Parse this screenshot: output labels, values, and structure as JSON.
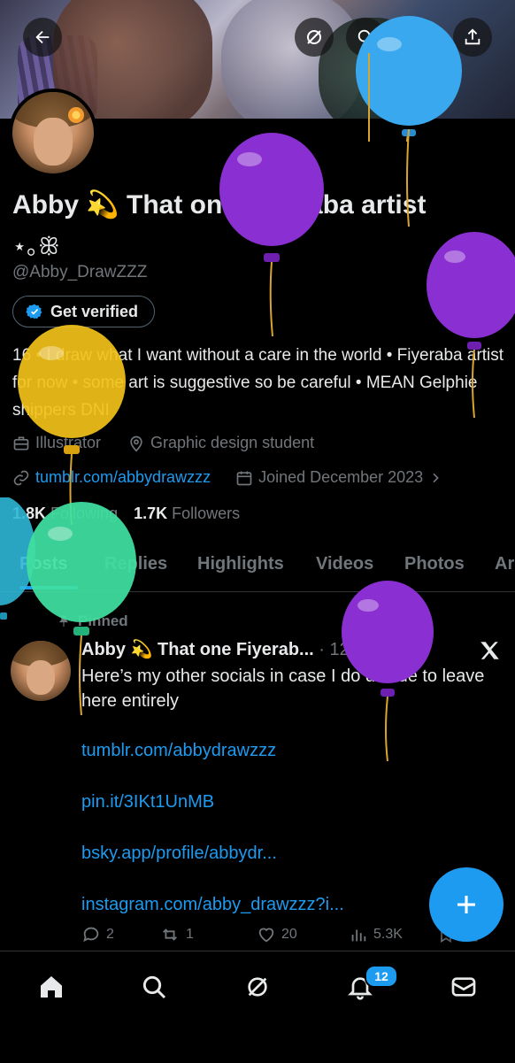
{
  "profile": {
    "display_name": "Abby 💫 That one Fiyeraba artist",
    "display_name_cont": "⋆｡ꕥ",
    "handle": "@Abby_DrawZZZ",
    "verify_label": "Get verified",
    "bio": "16 • I draw what I want without a care in the world • Fiyeraba artist for now • some art is suggestive so be careful • MEAN Gelphie shippers DNI",
    "category": "Illustrator",
    "location": "Graphic design student",
    "website": "tumblr.com/abbydrawzzz",
    "joined": "Joined December 2023",
    "following_count": "1.8K",
    "following_label": "Following",
    "followers_count": "1.7K",
    "followers_label": "Followers"
  },
  "tabs": [
    "Posts",
    "Replies",
    "Highlights",
    "Videos",
    "Photos",
    "Ar"
  ],
  "pinned_label": "Pinned",
  "post": {
    "author": "Abby 💫 That one Fiyerab...",
    "separator": "·",
    "date": "12/24/25",
    "text": "Here’s my other socials in case I do decide to leave here entirely",
    "links": [
      "tumblr.com/abbydrawzzz",
      "pin.it/3IKt1UnMB",
      "bsky.app/profile/abbydr...",
      "instagram.com/abby_drawzzz?i..."
    ],
    "replies": "2",
    "reposts": "1",
    "likes": "20",
    "views": "5.3K"
  },
  "notifications_badge": "12",
  "colors": {
    "accent": "#1d9bf0",
    "text": "#e7e9ea",
    "secondary": "#71767b",
    "balloon_purple": "#8a2fd1",
    "balloon_blue": "#3aa8ee",
    "balloon_yellow": "#f2c21a",
    "balloon_green": "#3fe0a0"
  },
  "icons": {
    "back": "arrow-left-icon",
    "grok": "grok-icon",
    "search": "search-icon",
    "edit": "pencil-icon",
    "share": "share-icon",
    "verified": "verified-badge-icon",
    "category": "briefcase-icon",
    "location": "location-pin-icon",
    "link": "link-icon",
    "calendar": "calendar-icon",
    "pin": "pin-icon",
    "x_logo": "x-logo-icon"
  }
}
